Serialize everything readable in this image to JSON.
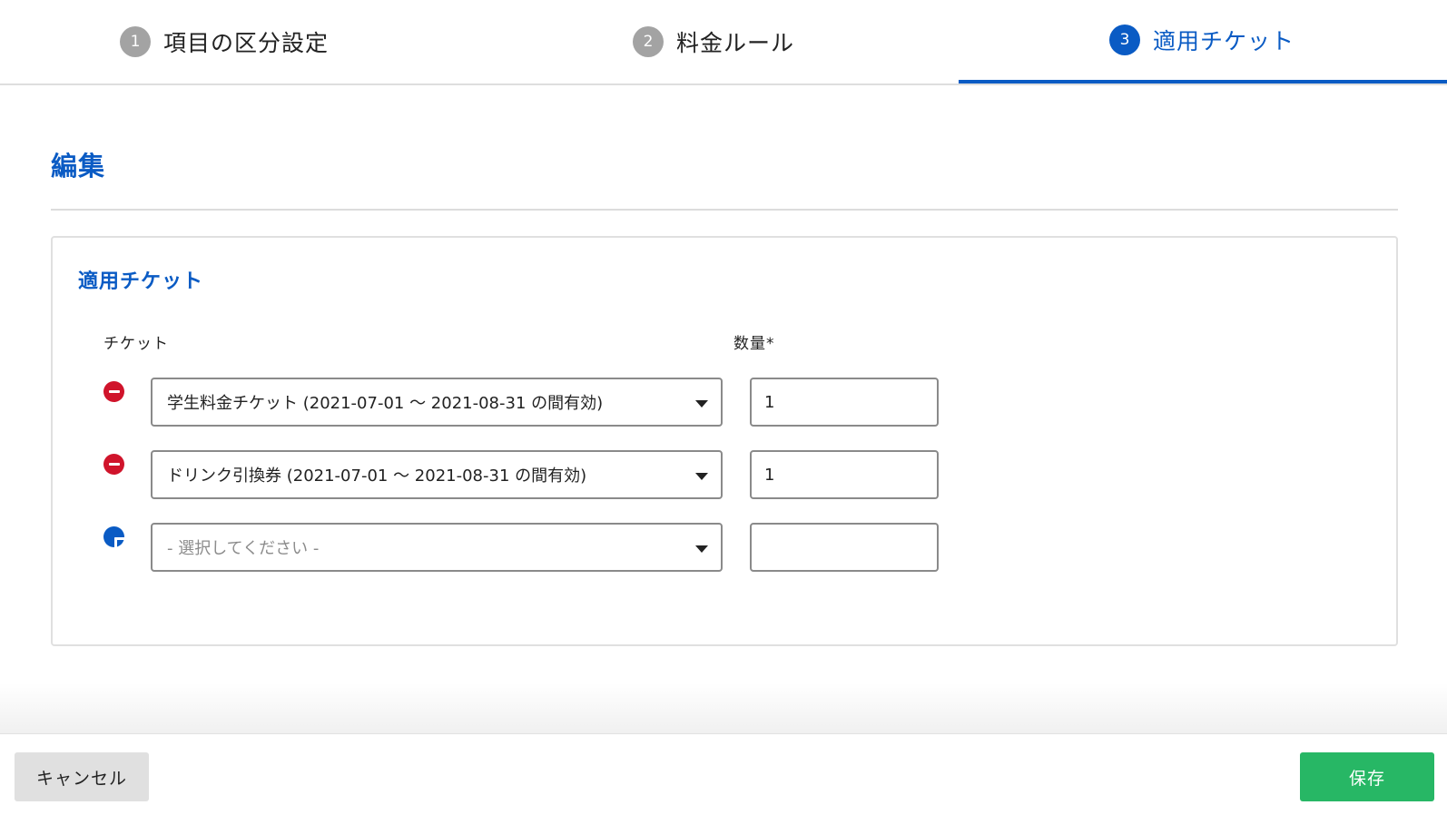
{
  "stepper": {
    "steps": [
      {
        "number": "1",
        "label": "項目の区分設定",
        "state": "done"
      },
      {
        "number": "2",
        "label": "料金ルール",
        "state": "done"
      },
      {
        "number": "3",
        "label": "適用チケット",
        "state": "active"
      }
    ],
    "active_color": "#0a5bc4",
    "inactive_color": "#a3a3a3"
  },
  "page": {
    "title": "編集"
  },
  "card": {
    "title": "適用チケット",
    "columns": {
      "ticket": "チケット",
      "quantity": "数量*"
    },
    "rows": [
      {
        "action": "remove",
        "ticket": "学生料金チケット (2021-07-01 〜 2021-08-31 の間有効)",
        "quantity": "1"
      },
      {
        "action": "remove",
        "ticket": "ドリンク引換券 (2021-07-01 〜 2021-08-31 の間有効)",
        "quantity": "1"
      },
      {
        "action": "add",
        "ticket": "",
        "quantity": "",
        "placeholder": "- 選択してください -"
      }
    ]
  },
  "footer": {
    "cancel_label": "キャンセル",
    "save_label": "保存"
  },
  "colors": {
    "primary": "#0a5bc4",
    "remove": "#d0142b",
    "save": "#27b765",
    "cancel_bg": "#e0e0e0"
  },
  "icons": {
    "remove": "minus-circle-icon",
    "add": "plus-circle-icon",
    "dropdown": "caret-down-icon"
  }
}
